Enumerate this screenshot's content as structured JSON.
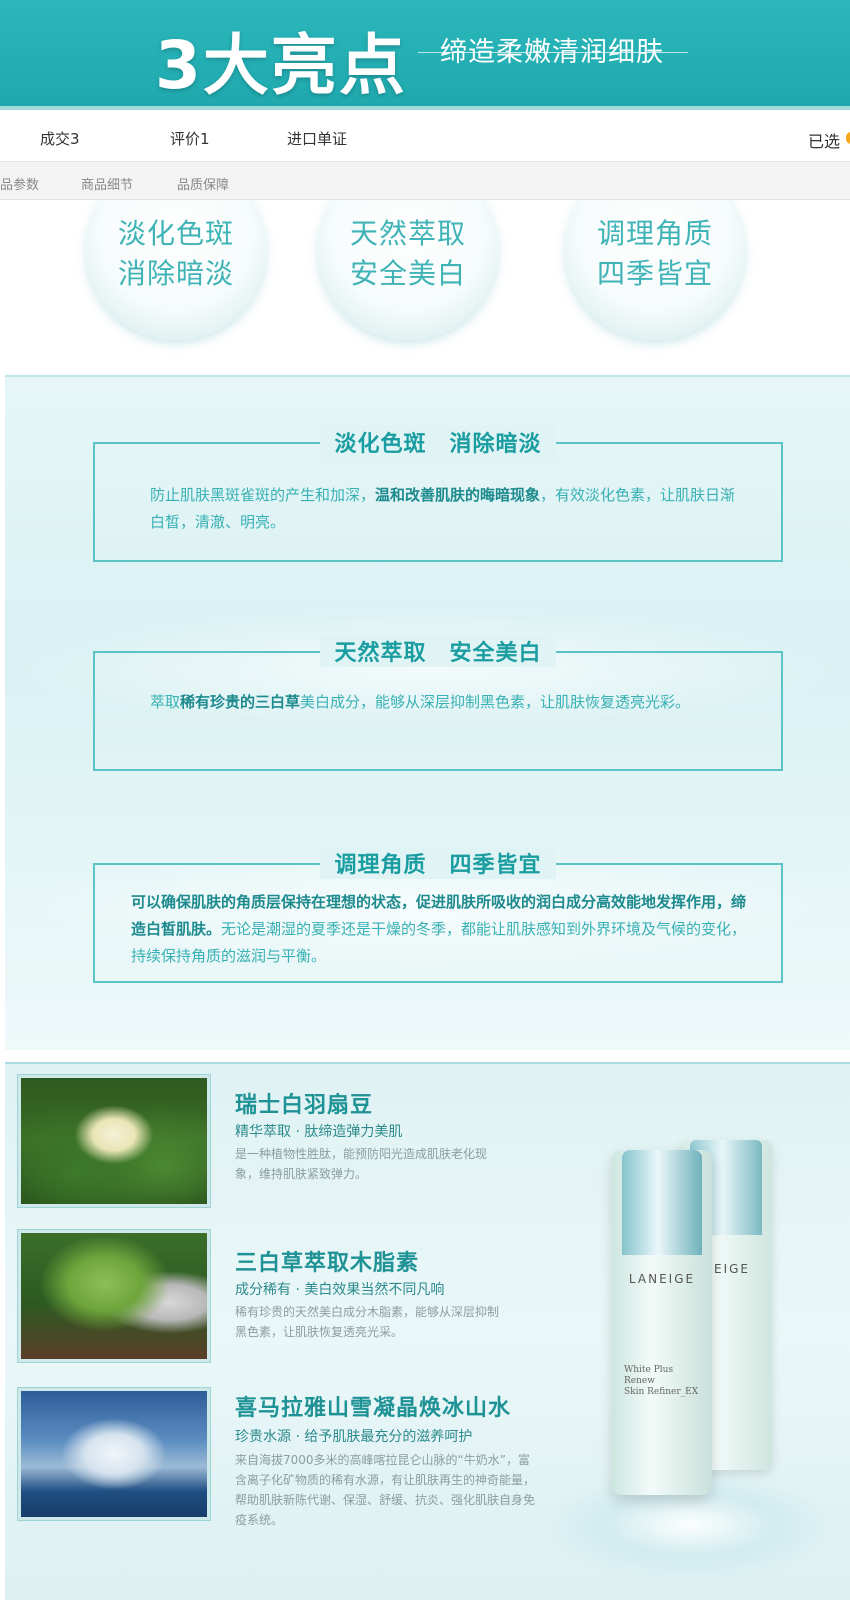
{
  "banner": {
    "title": "3大亮点",
    "subtitle": "缔造柔嫩清润细肤"
  },
  "topnav": {
    "items": [
      "成交3",
      "评价1",
      "进口单证"
    ],
    "selected": "已选"
  },
  "subnav": {
    "items": [
      "品参数",
      "商品细节",
      "品质保障"
    ]
  },
  "highlights": [
    {
      "line1": "淡化色斑",
      "line2": "消除暗淡"
    },
    {
      "line1": "天然萃取",
      "line2": "安全美白"
    },
    {
      "line1": "调理角质",
      "line2": "四季皆宜"
    }
  ],
  "features": [
    {
      "title": "淡化色斑　消除暗淡",
      "text_a": "防止肌肤黑斑雀斑的产生和加深，",
      "text_b": "温和改善肌肤的晦暗现象",
      "text_c": "，有效淡化色素，让肌肤日渐白皙，清澈、明亮。"
    },
    {
      "title": "天然萃取　安全美白",
      "text_a": "萃取",
      "text_b": "稀有珍贵的三白草",
      "text_c": "美白成分，能够从深层抑制黑色素，让肌肤恢复透亮光彩。"
    },
    {
      "title": "调理角质　四季皆宜",
      "text_a": "",
      "text_b": "可以确保肌肤的角质层保持在理想的状态，促进肌肤所吸收的润白成分高效能地发挥作用，缔造白皙肌肤。",
      "text_c": "无论是潮湿的夏季还是干燥的冬季，都能让肌肤感知到外界环境及气候的变化，持续保持角质的滋润与平衡。"
    }
  ],
  "ingredients": [
    {
      "title": "瑞士白羽扇豆",
      "subtitle": "精华萃取 · 肽缔造弹力美肌",
      "desc": "是一种植物性胜肽，能预防阳光造成肌肤老化现象，维持肌肤紧致弹力。"
    },
    {
      "title": "三白草萃取木脂素",
      "subtitle": "成分稀有 · 美白效果当然不同凡响",
      "desc": "稀有珍贵的天然美白成分木脂素，能够从深层抑制黑色素，让肌肤恢复透亮光采。"
    },
    {
      "title": "喜马拉雅山雪凝晶焕冰山水",
      "subtitle": "珍贵水源 · 给予肌肤最充分的滋养呵护",
      "desc": "来自海拔7000多米的高峰喀拉昆仑山脉的“牛奶水”，富含离子化矿物质的稀有水源，有让肌肤再生的神奇能量，帮助肌肤新陈代谢、保湿、舒缓、抗炎、强化肌肤自身免疫系统。"
    }
  ],
  "product": {
    "brand_front": "LANEIGE",
    "brand_back": "EIGE",
    "label_line1": "White Plus Renew",
    "label_line2": "Skin Refiner_EX"
  },
  "colors": {
    "banner": "#1fa9ae",
    "accent_text": "#1a9da1",
    "box_border": "#5cc4c7"
  }
}
